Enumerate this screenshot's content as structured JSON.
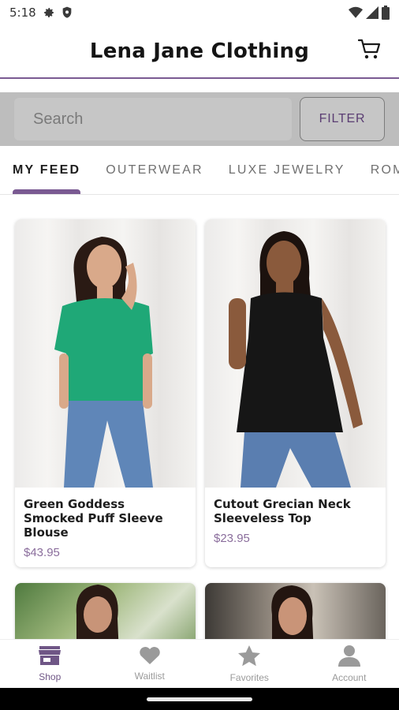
{
  "status_bar": {
    "time": "5:18",
    "icons": [
      "gear-icon",
      "shield-icon",
      "wifi-icon",
      "signal-icon",
      "battery-icon"
    ]
  },
  "header": {
    "title": "Lena Jane Clothing",
    "cart_icon": "cart-icon",
    "accent_color": "#7a5a92"
  },
  "search": {
    "placeholder": "Search",
    "value": "",
    "filter_label": "FILTER"
  },
  "tabs": [
    {
      "label": "MY FEED",
      "active": true
    },
    {
      "label": "OUTERWEAR",
      "active": false
    },
    {
      "label": "LUXE JEWELRY",
      "active": false
    },
    {
      "label": "ROM",
      "active": false
    }
  ],
  "products": [
    {
      "title": "Green Goddess Smocked Puff Sleeve Blouse",
      "price": "$43.95",
      "top_color": "#1fa877",
      "bottom_color": "#5f86b8",
      "skin": "#d9a98a",
      "hair": "#2a1a14"
    },
    {
      "title": "Cutout Grecian Neck Sleeveless Top",
      "price": "$23.95",
      "top_color": "#161616",
      "bottom_color": "#5a7eb0",
      "skin": "#8a5a3c",
      "hair": "#1c120e"
    },
    {
      "title": "",
      "price": "",
      "top_color": "#e9a3b8",
      "bottom_color": "#e9a3b8",
      "skin": "#c89478",
      "hair": "#2a1a14"
    },
    {
      "title": "",
      "price": "",
      "top_color": "#2c2c2c",
      "bottom_color": "#2c2c2c",
      "skin": "#c99478",
      "hair": "#231510"
    }
  ],
  "bottom_nav": [
    {
      "label": "Shop",
      "icon": "shop-icon",
      "active": true
    },
    {
      "label": "Waitlist",
      "icon": "heart-icon",
      "active": false
    },
    {
      "label": "Favorites",
      "icon": "star-icon",
      "active": false
    },
    {
      "label": "Account",
      "icon": "person-icon",
      "active": false
    }
  ]
}
